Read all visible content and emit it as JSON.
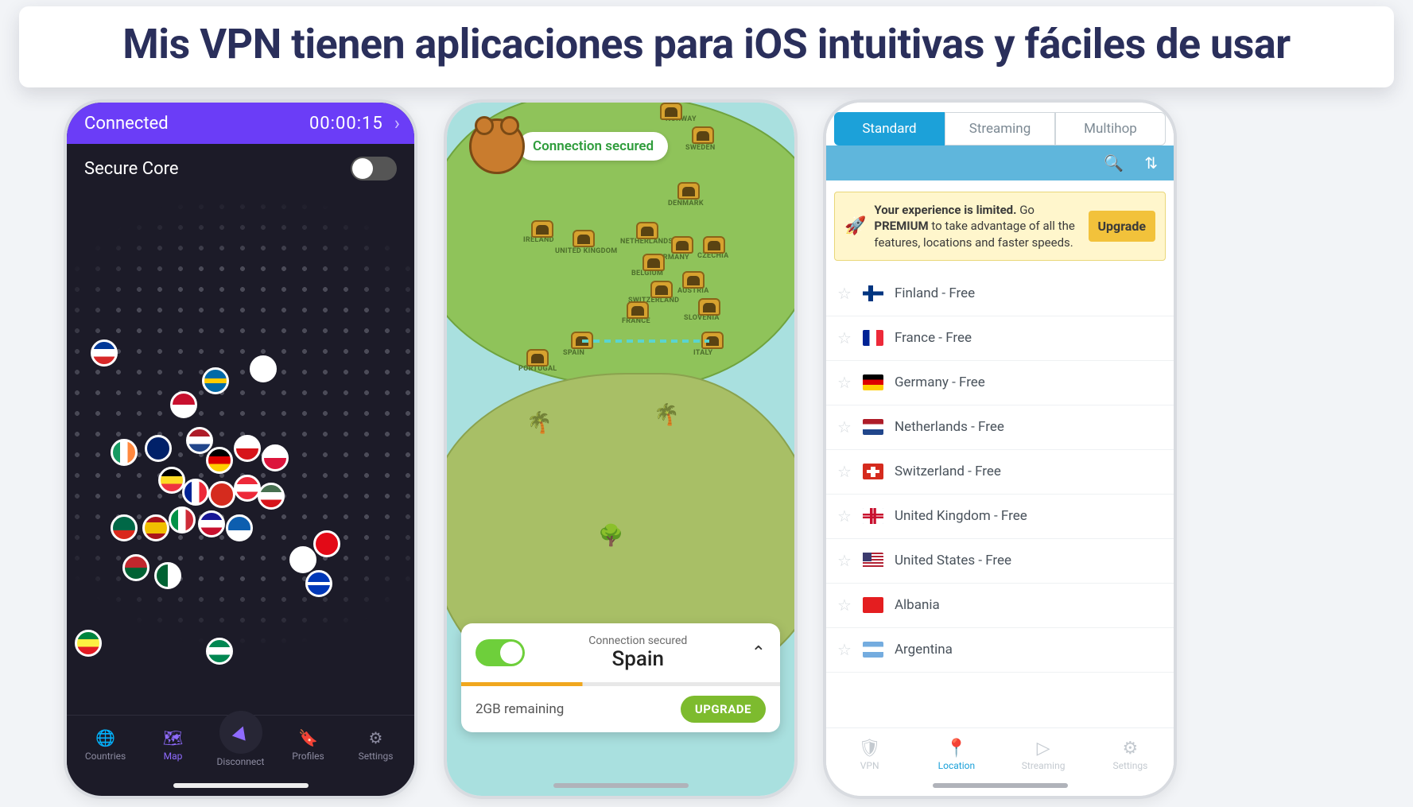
{
  "banner": {
    "text": "Mis VPN tienen aplicaciones para iOS intuitivas y fáciles de usar"
  },
  "phone1": {
    "status_connected": "Connected",
    "status_timer": "00:00:15",
    "secure_core_label": "Secure Core",
    "secure_core_on": false,
    "nav": {
      "countries": "Countries",
      "map": "Map",
      "disconnect": "Disconnect",
      "profiles": "Profiles",
      "settings": "Settings"
    }
  },
  "phone2": {
    "chip_text": "Connection secured",
    "map_labels": [
      "NORWAY",
      "SWEDEN",
      "DENMARK",
      "IRELAND",
      "UNITED KINGDOM",
      "NETHERLANDS",
      "GERMANY",
      "CZECHIA",
      "BELGIUM",
      "SWITZERLAND",
      "AUSTRIA",
      "FRANCE",
      "SLOVENIA",
      "SPAIN",
      "ITALY",
      "PORTUGAL"
    ],
    "card": {
      "sub": "Connection secured",
      "country": "Spain",
      "switch_on": true,
      "remaining": "2GB remaining",
      "upgrade": "UPGRADE"
    }
  },
  "phone3": {
    "tabs": {
      "standard": "Standard",
      "streaming": "Streaming",
      "multihop": "Multihop"
    },
    "banner": {
      "line1_bold": "Your experience is limited.",
      "line1_rest": " Go ",
      "line2_bold": "PREMIUM",
      "line2_rest": " to take advantage of all the features, locations and faster speeds.",
      "button": "Upgrade"
    },
    "countries": [
      {
        "name": "Finland - Free",
        "flag": "fl-finland"
      },
      {
        "name": "France - Free",
        "flag": "fl-france"
      },
      {
        "name": "Germany - Free",
        "flag": "fl-germany"
      },
      {
        "name": "Netherlands - Free",
        "flag": "fl-neth"
      },
      {
        "name": "Switzerland - Free",
        "flag": "fl-swiss"
      },
      {
        "name": "United Kingdom - Free",
        "flag": "fl-uk"
      },
      {
        "name": "United States - Free",
        "flag": "fl-us"
      },
      {
        "name": "Albania",
        "flag": "fl-albania"
      },
      {
        "name": "Argentina",
        "flag": "fl-argent"
      }
    ],
    "nav": {
      "vpn": "VPN",
      "location": "Location",
      "streaming": "Streaming",
      "settings": "Settings"
    }
  }
}
